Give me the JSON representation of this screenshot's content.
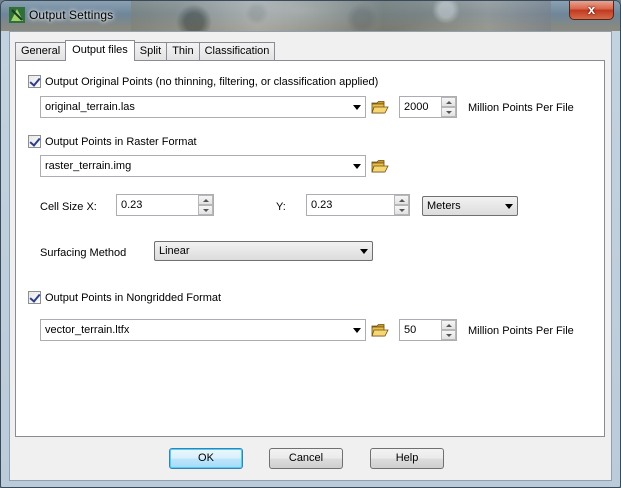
{
  "window": {
    "title": "Output Settings",
    "close_label": "x"
  },
  "tabs": [
    {
      "label": "General"
    },
    {
      "label": "Output files"
    },
    {
      "label": "Split"
    },
    {
      "label": "Thin"
    },
    {
      "label": "Classification"
    }
  ],
  "active_tab": "Output files",
  "original": {
    "checkbox_label": "Output Original Points (no thinning, filtering, or classification applied)",
    "checked": true,
    "file": "original_terrain.las",
    "points_per_file": "2000",
    "points_label": "Million Points Per File"
  },
  "raster": {
    "checkbox_label": "Output Points in Raster Format",
    "checked": true,
    "file": "raster_terrain.img",
    "cell_size_label": "Cell Size  X:",
    "cell_x": "0.23",
    "y_label": "Y:",
    "cell_y": "0.23",
    "units": "Meters",
    "surfacing_label": "Surfacing Method",
    "surfacing_method": "Linear"
  },
  "nongridded": {
    "checkbox_label": "Output Points in Nongridded Format",
    "checked": true,
    "file": "vector_terrain.ltfx",
    "points_per_file": "50",
    "points_label": "Million Points Per File"
  },
  "buttons": {
    "ok": "OK",
    "cancel": "Cancel",
    "help": "Help"
  },
  "icons": {
    "app": "app-icon",
    "folder": "open-folder-icon",
    "close": "close-icon"
  }
}
